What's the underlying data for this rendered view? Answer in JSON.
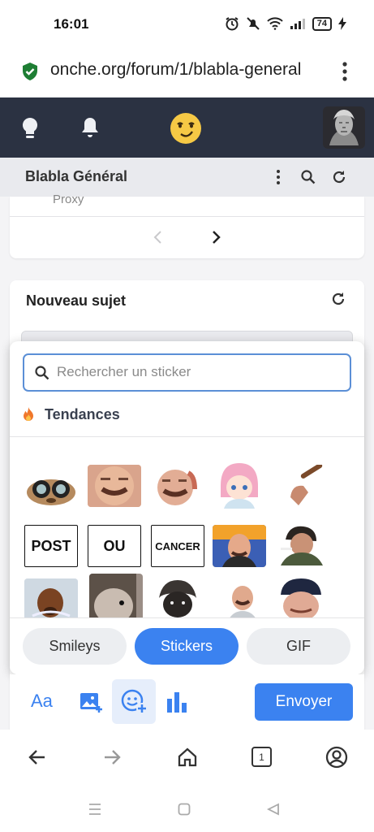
{
  "status_bar": {
    "time": "16:01",
    "battery": "74"
  },
  "browser": {
    "url": "onche.org/forum/1/blabla-general",
    "tab_count": "1"
  },
  "forum": {
    "title": "Blabla Général",
    "proxy_text": "Proxy",
    "new_topic_title": "Nouveau sujet"
  },
  "sticker_picker": {
    "search_placeholder": "Rechercher un sticker",
    "trending_label": "Tendances",
    "text_stickers": [
      "POST",
      "OU",
      "CANCER"
    ],
    "tabs": [
      {
        "label": "Smileys",
        "active": false
      },
      {
        "label": "Stickers",
        "active": true
      },
      {
        "label": "GIF",
        "active": false
      }
    ]
  },
  "toolbar": {
    "font_label": "Aa",
    "send_label": "Envoyer"
  },
  "colors": {
    "accent": "#3b82f0",
    "header": "#2b3242",
    "brand_smiley": "#f6c945"
  }
}
